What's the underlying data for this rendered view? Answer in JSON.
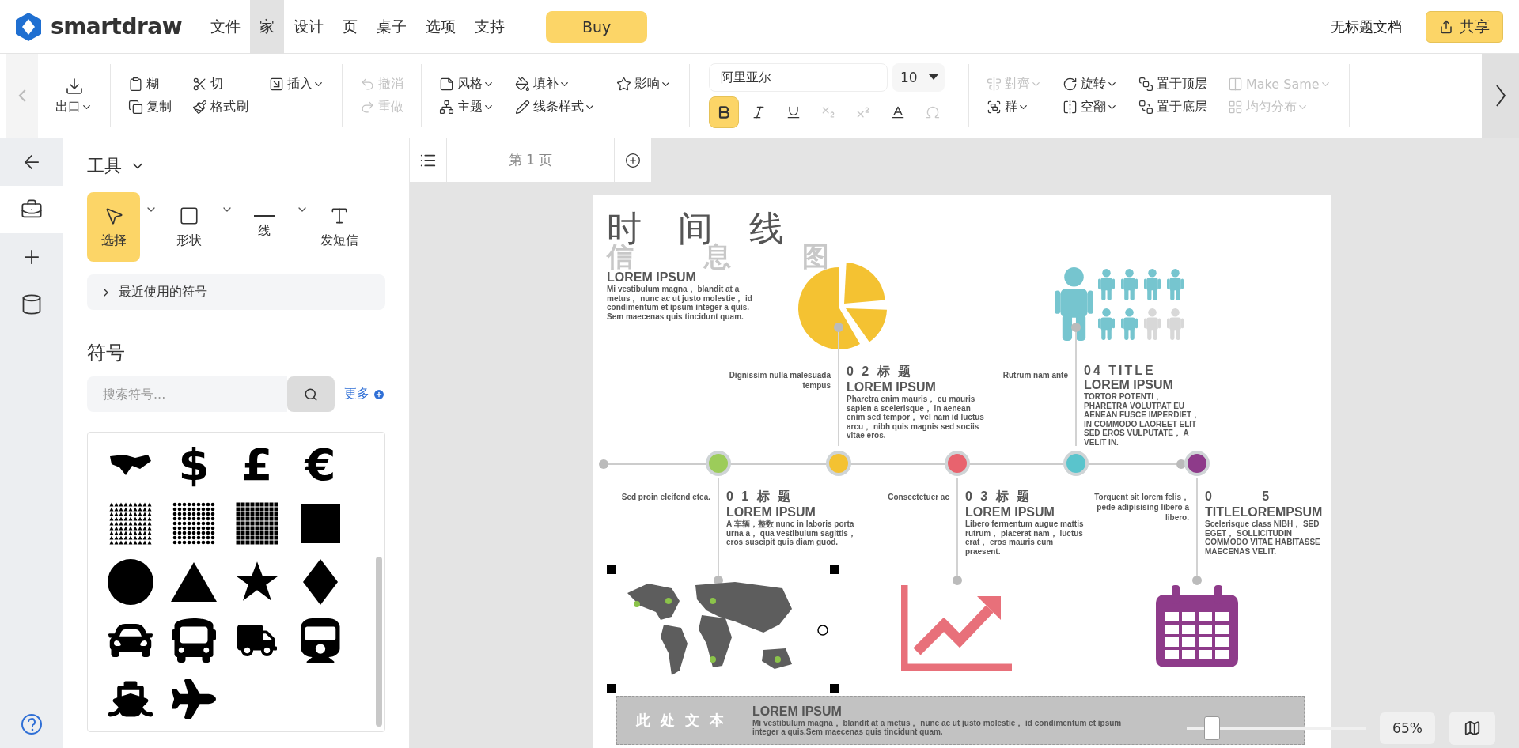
{
  "app": {
    "logo": "smartdraw"
  },
  "menu": [
    {
      "label": "文件",
      "selected": false
    },
    {
      "label": "家",
      "selected": true
    },
    {
      "label": "设计",
      "selected": false
    },
    {
      "label": "页",
      "selected": false
    },
    {
      "label": "桌子",
      "selected": false
    },
    {
      "label": "选项",
      "selected": false
    },
    {
      "label": "支持",
      "selected": false
    }
  ],
  "buy_button": "Buy",
  "document_title": "无标题文档",
  "share_button": "共享",
  "ribbon": {
    "groups": [
      {
        "items": [
          {
            "label": "出口",
            "dropdown": true,
            "disabled": false
          }
        ]
      },
      {
        "items": [
          {
            "label": "糊",
            "dropdown": false,
            "disabled": false
          },
          {
            "label": "复制",
            "dropdown": false,
            "disabled": false
          },
          {
            "label": "切",
            "dropdown": false,
            "disabled": false
          },
          {
            "label": "格式刷",
            "dropdown": false,
            "disabled": false
          },
          {
            "label": "插入",
            "dropdown": true,
            "disabled": false
          }
        ]
      },
      {
        "items": [
          {
            "label": "撤消",
            "dropdown": false,
            "disabled": true
          },
          {
            "label": "重做",
            "dropdown": false,
            "disabled": true
          }
        ]
      },
      {
        "items": [
          {
            "label": "风格",
            "dropdown": true,
            "disabled": false
          },
          {
            "label": "主题",
            "dropdown": true,
            "disabled": false
          },
          {
            "label": "填补",
            "dropdown": true,
            "disabled": false
          },
          {
            "label": "线条样式",
            "dropdown": true,
            "disabled": false
          },
          {
            "label": "影响",
            "dropdown": true,
            "disabled": false
          }
        ]
      },
      {
        "items": [
          {
            "label": "對齊",
            "dropdown": true,
            "disabled": true
          },
          {
            "label": "群",
            "dropdown": true,
            "disabled": false
          },
          {
            "label": "旋转",
            "dropdown": true,
            "disabled": false
          },
          {
            "label": "空翻",
            "dropdown": true,
            "disabled": false
          },
          {
            "label": "置于顶层",
            "dropdown": false,
            "disabled": false
          },
          {
            "label": "置于底层",
            "dropdown": false,
            "disabled": false
          },
          {
            "label": "Make Same",
            "dropdown": true,
            "disabled": true
          },
          {
            "label": "均匀分布",
            "dropdown": true,
            "disabled": true
          }
        ]
      }
    ],
    "font": {
      "value": "阿里亚尔",
      "size": "10"
    },
    "format_buttons": [
      {
        "selected": true,
        "disabled": false
      },
      {
        "selected": false,
        "disabled": false
      },
      {
        "selected": false,
        "disabled": false
      },
      {
        "selected": false,
        "disabled": true
      },
      {
        "selected": false,
        "disabled": true
      },
      {
        "selected": false,
        "disabled": false
      },
      {
        "selected": false,
        "disabled": true
      }
    ]
  },
  "rail": [
    {
      "selected": false
    },
    {
      "selected": true
    },
    {
      "selected": false
    },
    {
      "selected": false
    }
  ],
  "tools": {
    "heading": "工具",
    "items": [
      {
        "label": "选择",
        "selected": true,
        "dropdown": true
      },
      {
        "label": "形状",
        "selected": false,
        "dropdown": true
      },
      {
        "label": "线",
        "selected": false,
        "dropdown": true
      },
      {
        "label": "发短信",
        "selected": false,
        "dropdown": false
      }
    ]
  },
  "recent_symbols": {
    "label": "最近使用的符号",
    "expanded": false
  },
  "symbols": {
    "heading": "符号",
    "search": {
      "placeholder": "搜索符号..."
    },
    "more": "更多",
    "items": [
      {
        "kind": "map"
      },
      {
        "kind": "glyph",
        "glyph": "$"
      },
      {
        "kind": "glyph",
        "glyph": "£"
      },
      {
        "kind": "glyph",
        "glyph": "€"
      },
      {
        "kind": "triangles"
      },
      {
        "kind": "dots"
      },
      {
        "kind": "grid"
      },
      {
        "kind": "square"
      },
      {
        "kind": "circle"
      },
      {
        "kind": "triangle"
      },
      {
        "kind": "star"
      },
      {
        "kind": "diamond"
      },
      {
        "kind": "car"
      },
      {
        "kind": "bus"
      },
      {
        "kind": "truck"
      },
      {
        "kind": "train"
      },
      {
        "kind": "ship"
      },
      {
        "kind": "plane"
      }
    ]
  },
  "page_tabs": [
    {
      "label": "第 1 页",
      "selected": true
    }
  ],
  "document": {
    "title": "时 间 线",
    "subtitle": "信 息 图",
    "intro": {
      "heading": "LOREM IPSUM",
      "body": "Mi vestibulum magna， blandit at a metus， nunc ac ut justo molestie， id condimentum et ipsum integer a quis. Sem maecenas quis tincidunt quam."
    },
    "milestones": [
      {
        "color": "#9ccc5a",
        "caption": "Sed proin eleifend etea.",
        "heading": "0 1 标 题",
        "subheading": "LOREM IPSUM",
        "body": "A 车辆，整数 nunc in laboris porta urna a， qua vestibulum sagittis， eros suscipit quis diam guod."
      },
      {
        "color": "#f4c232",
        "caption": "Dignissim nulla malesuada tempus",
        "heading": "0 2 标 题",
        "subheading": "LOREM IPSUM",
        "body": "Pharetra enim mauris， eu mauris sapien a scelerisque， in aenean enim sed tempor， vel nam id luctus arcu， nibh quis magnis sed sociis vitae eros."
      },
      {
        "color": "#e8636e",
        "caption": "Consectetuer ac",
        "heading": "0 3 标 题",
        "subheading": "LOREM IPSUM",
        "body": "Libero fermentum augue mattis rutrum， placerat nam， luctus erat， eros mauris cum praesent."
      },
      {
        "color": "#5ac4cc",
        "caption": "Rutrum nam ante",
        "heading": "04 TITLE",
        "subheading": "LOREM IPSUM",
        "body": "TORTOR POTENTI， PHARETRA VOLUTPAT EU AENEAN FUSCE IMPERDIET， IN COMMODO LAOREET ELIT SED EROS VULPUTATE， A VELIT IN."
      },
      {
        "color": "#8e3b8a",
        "caption": "Torquent sit lorem felis，pede adipisising libero a libero.",
        "heading": "0 　 　 5",
        "subheading": "TITLELOREMPSUM",
        "body": "Scelerisque class NIBH， SED EGET， SOLLICITUDIN COMMODO VITAE HABITASSE MAECENAS VELIT."
      }
    ],
    "map": {
      "selected": true
    },
    "banner": {
      "label": "此 处 文 本",
      "heading": "LOREM IPSUM",
      "body": "Mi vestibulum magna， blandit at a metus， nunc ac ut justo molestie， id condimentum et ipsum integer a quis.Sem maecenas quis tincidunt quam."
    }
  },
  "zoom": {
    "level": 0.14,
    "reading": "65%"
  }
}
